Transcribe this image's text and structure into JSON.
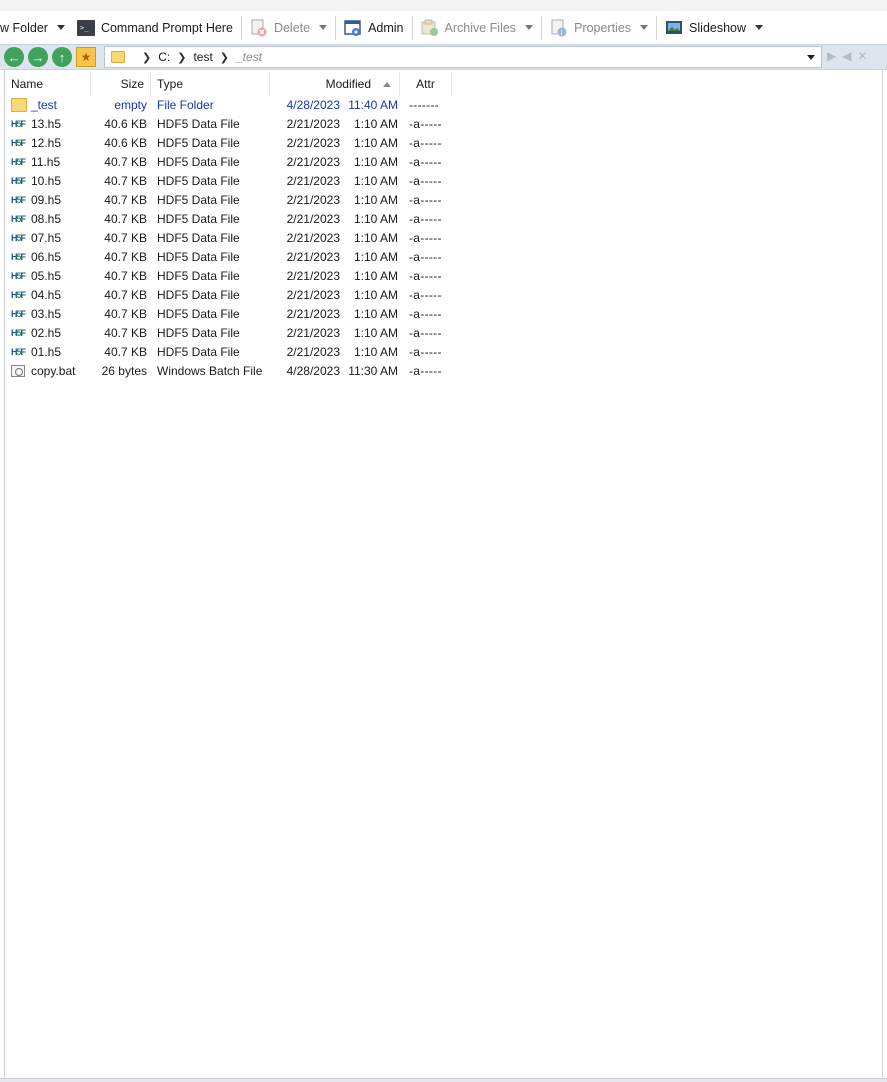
{
  "toolbar": {
    "items": [
      {
        "label": "w Folder",
        "icon": "new-folder-icon",
        "dropdown": true,
        "disabled": false
      },
      {
        "label": "Command Prompt Here",
        "icon": "command-prompt-icon",
        "dropdown": false,
        "disabled": false
      },
      {
        "label": "Delete",
        "icon": "delete-icon",
        "dropdown": true,
        "disabled": true
      },
      {
        "label": "Admin",
        "icon": "admin-icon",
        "dropdown": false,
        "disabled": false
      },
      {
        "label": "Archive Files",
        "icon": "archive-icon",
        "dropdown": true,
        "disabled": true
      },
      {
        "label": "Properties",
        "icon": "properties-icon",
        "dropdown": true,
        "disabled": true
      },
      {
        "label": "Slideshow",
        "icon": "slideshow-icon",
        "dropdown": true,
        "disabled": false
      }
    ]
  },
  "address": {
    "crumbs": [
      "C:",
      "test",
      "_test"
    ]
  },
  "columns": {
    "name": "Name",
    "size": "Size",
    "type": "Type",
    "modified": "Modified",
    "attr": "Attr"
  },
  "files": [
    {
      "name": "_test",
      "size": "empty",
      "type": "File Folder",
      "date": "4/28/2023",
      "time": "11:40 AM",
      "attr": "-------",
      "kind": "folder"
    },
    {
      "name": "13.h5",
      "size": "40.6 KB",
      "type": "HDF5 Data File",
      "date": "2/21/2023",
      "time": "1:10 AM",
      "attr": "-a-----",
      "kind": "h5"
    },
    {
      "name": "12.h5",
      "size": "40.6 KB",
      "type": "HDF5 Data File",
      "date": "2/21/2023",
      "time": "1:10 AM",
      "attr": "-a-----",
      "kind": "h5"
    },
    {
      "name": "11.h5",
      "size": "40.7 KB",
      "type": "HDF5 Data File",
      "date": "2/21/2023",
      "time": "1:10 AM",
      "attr": "-a-----",
      "kind": "h5"
    },
    {
      "name": "10.h5",
      "size": "40.7 KB",
      "type": "HDF5 Data File",
      "date": "2/21/2023",
      "time": "1:10 AM",
      "attr": "-a-----",
      "kind": "h5"
    },
    {
      "name": "09.h5",
      "size": "40.7 KB",
      "type": "HDF5 Data File",
      "date": "2/21/2023",
      "time": "1:10 AM",
      "attr": "-a-----",
      "kind": "h5"
    },
    {
      "name": "08.h5",
      "size": "40.7 KB",
      "type": "HDF5 Data File",
      "date": "2/21/2023",
      "time": "1:10 AM",
      "attr": "-a-----",
      "kind": "h5"
    },
    {
      "name": "07.h5",
      "size": "40.7 KB",
      "type": "HDF5 Data File",
      "date": "2/21/2023",
      "time": "1:10 AM",
      "attr": "-a-----",
      "kind": "h5"
    },
    {
      "name": "06.h5",
      "size": "40.7 KB",
      "type": "HDF5 Data File",
      "date": "2/21/2023",
      "time": "1:10 AM",
      "attr": "-a-----",
      "kind": "h5"
    },
    {
      "name": "05.h5",
      "size": "40.7 KB",
      "type": "HDF5 Data File",
      "date": "2/21/2023",
      "time": "1:10 AM",
      "attr": "-a-----",
      "kind": "h5"
    },
    {
      "name": "04.h5",
      "size": "40.7 KB",
      "type": "HDF5 Data File",
      "date": "2/21/2023",
      "time": "1:10 AM",
      "attr": "-a-----",
      "kind": "h5"
    },
    {
      "name": "03.h5",
      "size": "40.7 KB",
      "type": "HDF5 Data File",
      "date": "2/21/2023",
      "time": "1:10 AM",
      "attr": "-a-----",
      "kind": "h5"
    },
    {
      "name": "02.h5",
      "size": "40.7 KB",
      "type": "HDF5 Data File",
      "date": "2/21/2023",
      "time": "1:10 AM",
      "attr": "-a-----",
      "kind": "h5"
    },
    {
      "name": "01.h5",
      "size": "40.7 KB",
      "type": "HDF5 Data File",
      "date": "2/21/2023",
      "time": "1:10 AM",
      "attr": "-a-----",
      "kind": "h5"
    },
    {
      "name": "copy.bat",
      "size": "26 bytes",
      "type": "Windows Batch File",
      "date": "4/28/2023",
      "time": "11:30 AM",
      "attr": "-a-----",
      "kind": "bat"
    }
  ]
}
